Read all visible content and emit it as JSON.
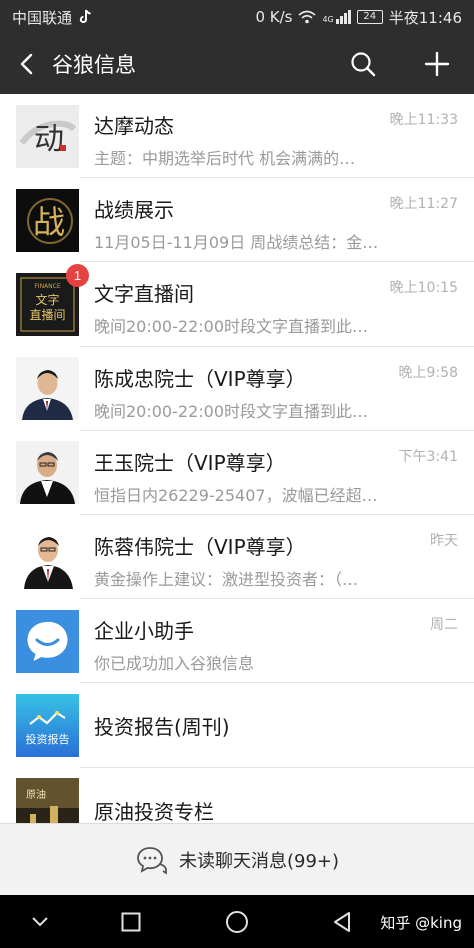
{
  "status_bar": {
    "carrier": "中国联通",
    "speed": "0 K/s",
    "network": "4G",
    "battery": "24",
    "time": "半夜11:46"
  },
  "header": {
    "title": "谷狼信息"
  },
  "conversations": [
    {
      "name": "达摩动态",
      "time": "晚上11:33",
      "preview": "主题：中期选举后时代 机会满满的…",
      "badge": "",
      "avatar": "dama-logo"
    },
    {
      "name": "战绩展示",
      "time": "晚上11:27",
      "preview": "11月05日-11月09日 周战绩总结：金…",
      "badge": "",
      "avatar": "zhanji-logo"
    },
    {
      "name": "文字直播间",
      "time": "晚上10:15",
      "preview": "晚间20:00-22:00时段文字直播到此…",
      "badge": "1",
      "avatar": "finance-live-logo"
    },
    {
      "name": "陈成忠院士（VIP尊享）",
      "time": "晚上9:58",
      "preview": "晚间20:00-22:00时段文字直播到此…",
      "badge": "",
      "avatar": "person-photo"
    },
    {
      "name": "王玉院士（VIP尊享）",
      "time": "下午3:41",
      "preview": "恒指日内26229-25407，波幅已经超…",
      "badge": "",
      "avatar": "person-photo"
    },
    {
      "name": "陈蓉伟院士（VIP尊享）",
      "time": "昨天",
      "preview": "黄金操作上建议：激进型投资者：（…",
      "badge": "",
      "avatar": "person-photo"
    },
    {
      "name": "企业小助手",
      "time": "周二",
      "preview": "你已成功加入谷狼信息",
      "badge": "",
      "avatar": "chat-bubble-icon"
    },
    {
      "name": "投资报告(周刊)",
      "time": "",
      "preview": "",
      "badge": "",
      "avatar": "report-logo"
    },
    {
      "name": "原油投资专栏",
      "time": "",
      "preview": "",
      "badge": "",
      "avatar": "oil-logo"
    }
  ],
  "avatar_texts": {
    "dama": "动",
    "zhanji": "战",
    "finance_top": "FINANCE",
    "finance_line1": "文字",
    "finance_line2": "直播间",
    "report": "投资报告",
    "oil": "原油"
  },
  "unread_bar": {
    "label": "未读聊天消息(99+)"
  },
  "watermark": "知乎 @king",
  "colors": {
    "bar_bg": "#2e2e2e",
    "badge": "#e64340",
    "assistant_blue": "#3b8ee0"
  }
}
